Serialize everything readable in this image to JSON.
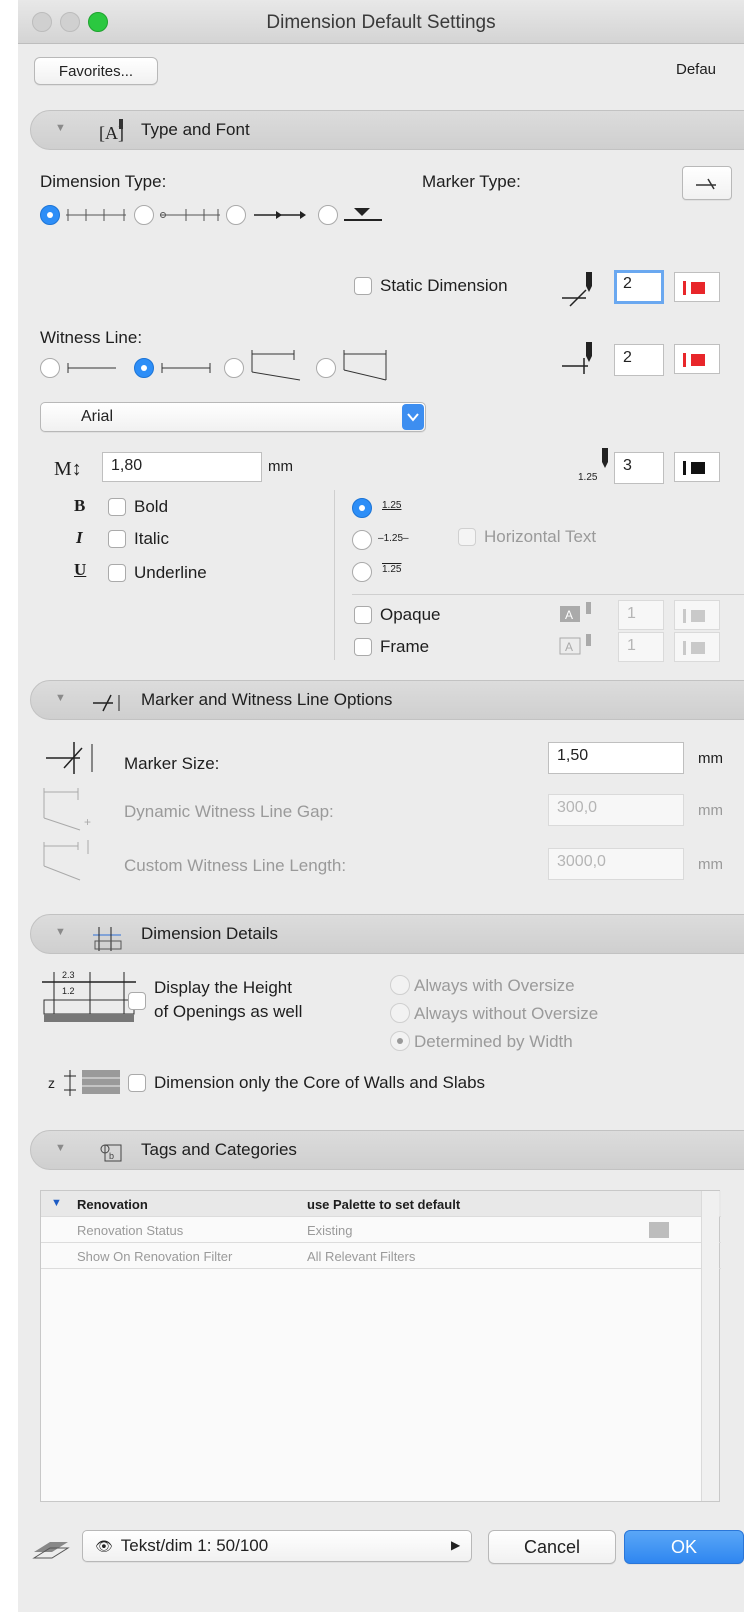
{
  "window": {
    "title": "Dimension Default Settings"
  },
  "toolbar": {
    "favorites_label": "Favorites...",
    "default_label": "Defau"
  },
  "sections": {
    "type_and_font": "Type and Font",
    "marker_witness": "Marker and Witness Line Options",
    "dimension_details": "Dimension Details",
    "tags_categories": "Tags and Categories"
  },
  "type_font": {
    "dimension_type_label": "Dimension Type:",
    "marker_type_label": "Marker Type:",
    "static_dimension_label": "Static Dimension",
    "static_dimension_pen": "2",
    "witness_line_label": "Witness Line:",
    "witness_pen": "2",
    "font_name": "Arial",
    "font_size": "1,80",
    "font_unit": "mm",
    "text_pen": "3",
    "bold_label": "Bold",
    "italic_label": "Italic",
    "underline_label": "Underline",
    "text_pos_sample": "1.25",
    "horizontal_text_label": "Horizontal Text",
    "opaque_label": "Opaque",
    "frame_label": "Frame",
    "opaque_pen": "1",
    "frame_pen": "1",
    "pen_red": "#e8262a",
    "pen_black": "#111111"
  },
  "marker": {
    "marker_size_label": "Marker Size:",
    "marker_size_value": "1,50",
    "dynamic_gap_label": "Dynamic Witness Line Gap:",
    "dynamic_gap_value": "300,0",
    "custom_length_label": "Custom Witness Line Length:",
    "custom_length_value": "3000,0",
    "unit": "mm"
  },
  "details": {
    "display_height_line1": "Display the Height",
    "display_height_line2": "of Openings as well",
    "always_with": "Always with Oversize",
    "always_without": "Always without Oversize",
    "determined": "Determined by Width",
    "core_only": "Dimension only the Core of Walls and Slabs"
  },
  "tags": {
    "rows": [
      {
        "c1": "Renovation",
        "c2": "use Palette to set default"
      },
      {
        "c1": "Renovation Status",
        "c2": "Existing"
      },
      {
        "c1": "Show On Renovation Filter",
        "c2": "All Relevant Filters"
      }
    ]
  },
  "footer": {
    "layer_value": "Tekst/dim 1: 50/100",
    "cancel_label": "Cancel",
    "ok_label": "OK"
  }
}
